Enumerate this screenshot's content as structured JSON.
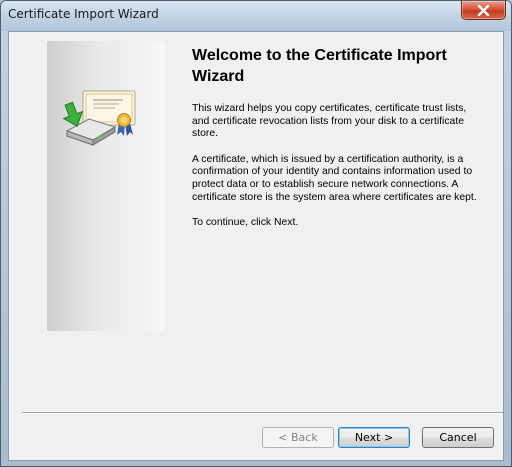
{
  "window": {
    "title": "Certificate Import Wizard",
    "close_icon": "close-icon"
  },
  "side_panel": {
    "icon": "certificate-import-icon"
  },
  "content": {
    "heading": "Welcome to the Certificate Import Wizard",
    "paragraphs": [
      "This wizard helps you copy certificates, certificate trust lists, and certificate revocation lists from your disk to a certificate store.",
      "A certificate, which is issued by a certification authority, is a confirmation of your identity and contains information used to protect data or to establish secure network connections. A certificate store is the system area where certificates are kept.",
      "To continue, click Next."
    ]
  },
  "buttons": {
    "back": "< Back",
    "next": "Next >",
    "cancel": "Cancel"
  },
  "colors": {
    "accent": "#3c7fb1",
    "close": "#c23a1f",
    "arrow": "#3bb13b"
  }
}
